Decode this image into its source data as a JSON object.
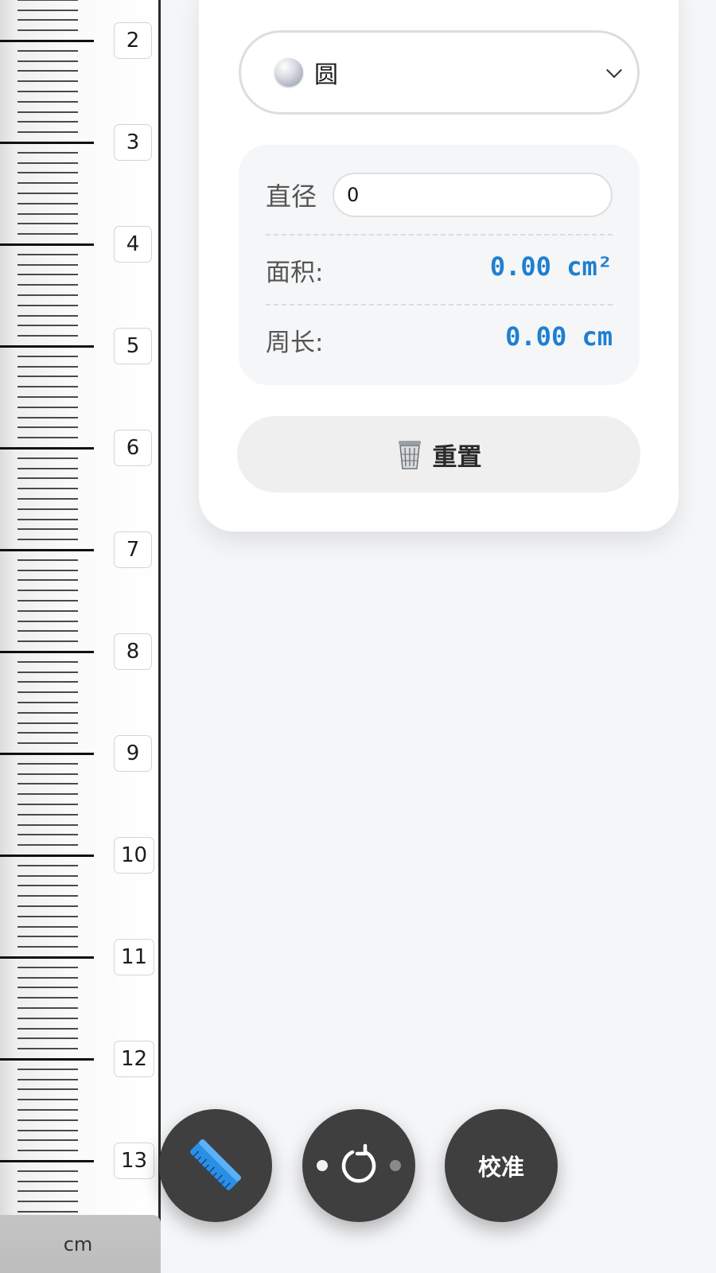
{
  "ruler": {
    "labels": [
      "2",
      "3",
      "4",
      "5",
      "6",
      "7",
      "8",
      "9",
      "10",
      "11",
      "12",
      "13"
    ],
    "unit": "cm"
  },
  "card": {
    "shape": {
      "icon": "sphere-icon",
      "name": "圆"
    },
    "diameter": {
      "label": "直径",
      "value": "0"
    },
    "area": {
      "label": "面积:",
      "value": "0.00 cm²"
    },
    "perimeter": {
      "label": "周长:",
      "value": "0.00 cm"
    },
    "reset": {
      "icon": "trash-icon",
      "label": "重置"
    }
  },
  "fabs": {
    "ruler": {
      "icon": "ruler-icon"
    },
    "rotate": {
      "icon": "rotate-icon"
    },
    "calibrate": {
      "label": "校准"
    }
  },
  "colors": {
    "accent": "#1e7fd2",
    "fab": "#3f3f3f",
    "background": "#f5f6f8"
  }
}
